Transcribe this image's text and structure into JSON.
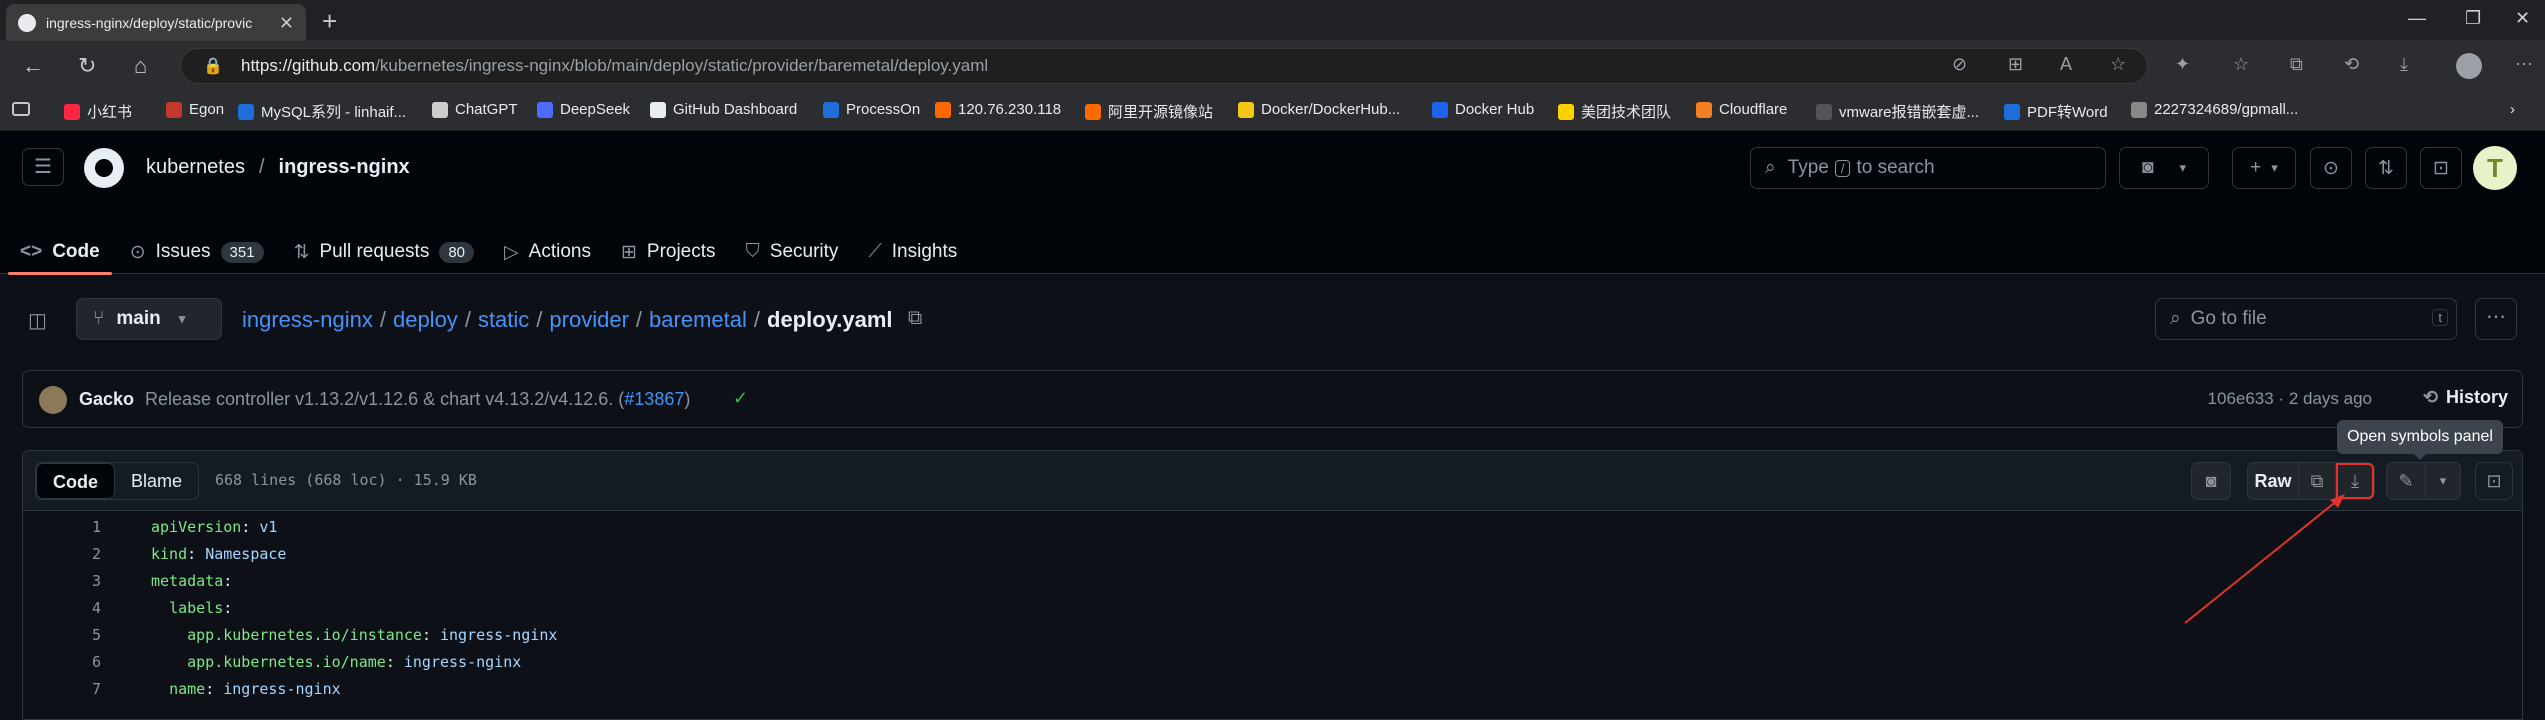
{
  "browser": {
    "tab_title": "ingress-nginx/deploy/static/provic",
    "url_host": "https://github.com",
    "url_path": "/kubernetes/ingress-nginx/blob/main/deploy/static/provider/baremetal/deploy.yaml",
    "bookmarks": [
      {
        "label": "小红书",
        "color": "#ff2442"
      },
      {
        "label": "Egon",
        "color": "#c0392b"
      },
      {
        "label": "MySQL系列 - linhaif...",
        "color": "#1e6fd9"
      },
      {
        "label": "ChatGPT",
        "color": "#cccccc"
      },
      {
        "label": "DeepSeek",
        "color": "#4d6bfe"
      },
      {
        "label": "GitHub Dashboard",
        "color": "#e6edf3"
      },
      {
        "label": "ProcessOn",
        "color": "#1e6fd9"
      },
      {
        "label": "120.76.230.118",
        "color": "#ff6a00"
      },
      {
        "label": "阿里开源镜像站",
        "color": "#ff6a00"
      },
      {
        "label": "Docker/DockerHub...",
        "color": "#f5c518"
      },
      {
        "label": "Docker Hub",
        "color": "#1d63ed"
      },
      {
        "label": "美团技术团队",
        "color": "#ffd100"
      },
      {
        "label": "Cloudflare",
        "color": "#f38020"
      },
      {
        "label": "vmware报错嵌套虚...",
        "color": "#555555"
      },
      {
        "label": "PDF转Word",
        "color": "#1e6fd9"
      },
      {
        "label": "2227324689/gpmall...",
        "color": "#888888"
      }
    ]
  },
  "header": {
    "owner": "kubernetes",
    "separator": "/",
    "repo": "ingress-nginx",
    "search_placeholder_pre": "Type",
    "search_key": "/",
    "search_placeholder_post": "to search"
  },
  "repo_nav": [
    {
      "label": "Code",
      "icon": "<>",
      "count": ""
    },
    {
      "label": "Issues",
      "icon": "⊙",
      "count": "351"
    },
    {
      "label": "Pull requests",
      "icon": "⇅",
      "count": "80"
    },
    {
      "label": "Actions",
      "icon": "▷",
      "count": ""
    },
    {
      "label": "Projects",
      "icon": "⊞",
      "count": ""
    },
    {
      "label": "Security",
      "icon": "⛉",
      "count": ""
    },
    {
      "label": "Insights",
      "icon": "⟋",
      "count": ""
    }
  ],
  "path_bar": {
    "branch": "main",
    "segments": [
      "ingress-nginx",
      "deploy",
      "static",
      "provider",
      "baremetal"
    ],
    "file": "deploy.yaml",
    "sep": "/",
    "goto_placeholder": "Go to file",
    "goto_key": "t"
  },
  "commit": {
    "author": "Gacko",
    "message": "Release controller v1.13.2/v1.12.6 & chart v4.13.2/v4.12.6. (",
    "pr": "#13867",
    "close": ")",
    "meta": "106e633 · 2 days ago",
    "history": "History"
  },
  "file": {
    "tab_code": "Code",
    "tab_blame": "Blame",
    "meta": "668 lines (668 loc) · 15.9 KB",
    "raw": "Raw",
    "tooltip": "Open symbols panel"
  },
  "code_lines": [
    {
      "n": "1",
      "indent": "",
      "key": "apiVersion",
      "value": "v1"
    },
    {
      "n": "2",
      "indent": "",
      "key": "kind",
      "value": "Namespace"
    },
    {
      "n": "3",
      "indent": "",
      "key": "metadata",
      "value": ""
    },
    {
      "n": "4",
      "indent": "  ",
      "key": "labels",
      "value": ""
    },
    {
      "n": "5",
      "indent": "    ",
      "key": "app.kubernetes.io/instance",
      "value": "ingress-nginx"
    },
    {
      "n": "6",
      "indent": "    ",
      "key": "app.kubernetes.io/name",
      "value": "ingress-nginx"
    },
    {
      "n": "7",
      "indent": "  ",
      "key": "name",
      "value": "ingress-nginx"
    }
  ],
  "colors": {
    "accent": "#f78166",
    "link": "#4493f8",
    "highlight": "#e5322d"
  }
}
